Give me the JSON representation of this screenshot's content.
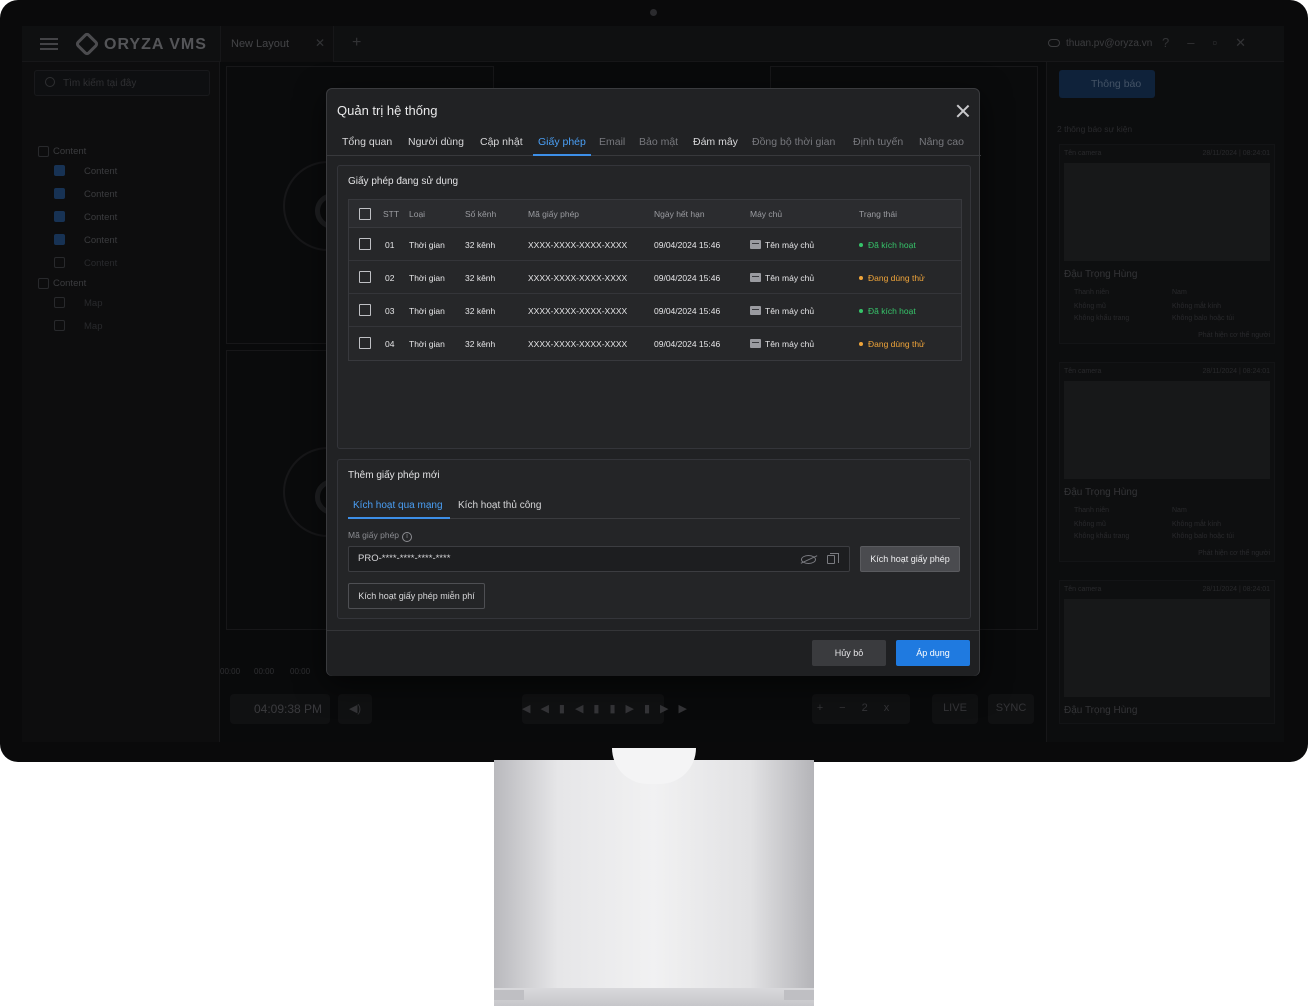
{
  "app": {
    "logo_text": "ORYZA VMS",
    "layout_tab": "New Layout",
    "user_email": "thuan.pv@oryza.vn",
    "search_placeholder": "Tìm kiếm tại đây"
  },
  "sidebar": {
    "groups": [
      {
        "label": "Content",
        "items": [
          "Content",
          "Content",
          "Content",
          "Content",
          "Content"
        ]
      },
      {
        "label": "Content",
        "items": [
          "Map",
          "Map"
        ]
      }
    ]
  },
  "playback": {
    "time": "04:09:38 PM",
    "timeline_ticks": [
      "00:00",
      "00:00",
      "00:00"
    ],
    "speed": "2x",
    "live_label": "LIVE",
    "sync_label": "SYNC"
  },
  "right_panel": {
    "notif_label": "Thông báo",
    "summary": "2 thông báo sự kiện",
    "events": [
      {
        "camera": "Tên camera",
        "time": "28/11/2024 | 08:24:01",
        "name": "Đậu Trọng Hùng",
        "attrs": [
          "Thanh niên",
          "Nam",
          "Không mũ",
          "Không mắt kính",
          "Không khẩu trang",
          "Không balo hoặc túi"
        ],
        "detect": "Phát hiện cơ thể người"
      },
      {
        "camera": "Tên camera",
        "time": "28/11/2024 | 08:24:01",
        "name": "Đậu Trọng Hùng",
        "attrs": [
          "Thanh niên",
          "Nam",
          "Không mũ",
          "Không mắt kính",
          "Không khẩu trang",
          "Không balo hoặc túi"
        ],
        "detect": "Phát hiện cơ thể người"
      },
      {
        "camera": "Tên camera",
        "time": "28/11/2024 | 08:24:01",
        "name": "Đậu Trọng Hùng",
        "attrs": [],
        "detect": ""
      }
    ]
  },
  "dialog": {
    "title": "Quản trị hệ thống",
    "tabs": [
      "Tổng quan",
      "Người dùng",
      "Cập nhật",
      "Giấy phép",
      "Email",
      "Bảo mật",
      "Đám mây",
      "Đồng bộ thời gian",
      "Định tuyến",
      "Nâng cao"
    ],
    "active_tab": "Giấy phép",
    "licenses_section": {
      "title": "Giấy phép đang sử dụng",
      "columns": [
        "STT",
        "Loại",
        "Số kênh",
        "Mã giấy phép",
        "Ngày hết hạn",
        "Máy chủ",
        "Trạng thái"
      ],
      "rows": [
        {
          "stt": "01",
          "type": "Thời gian",
          "channels": "32 kênh",
          "code": "XXXX-XXXX-XXXX-XXXX",
          "expiry": "09/04/2024 15:46",
          "server": "Tên máy chủ",
          "status": "Đã kích hoạt",
          "status_color": "#36c46a"
        },
        {
          "stt": "02",
          "type": "Thời gian",
          "channels": "32 kênh",
          "code": "XXXX-XXXX-XXXX-XXXX",
          "expiry": "09/04/2024 15:46",
          "server": "Tên máy chủ",
          "status": "Đang dùng thử",
          "status_color": "#f0a53a"
        },
        {
          "stt": "03",
          "type": "Thời gian",
          "channels": "32 kênh",
          "code": "XXXX-XXXX-XXXX-XXXX",
          "expiry": "09/04/2024 15:46",
          "server": "Tên máy chủ",
          "status": "Đã kích hoạt",
          "status_color": "#36c46a"
        },
        {
          "stt": "04",
          "type": "Thời gian",
          "channels": "32 kênh",
          "code": "XXXX-XXXX-XXXX-XXXX",
          "expiry": "09/04/2024 15:46",
          "server": "Tên máy chủ",
          "status": "Đang dùng thử",
          "status_color": "#f0a53a"
        }
      ]
    },
    "new_license": {
      "title": "Thêm giấy phép mới",
      "tabs": [
        "Kích hoạt qua mạng",
        "Kích hoạt thủ công"
      ],
      "field_label": "Mã giấy phép",
      "key_value": "PRO-****-****-****-****",
      "activate_button": "Kích hoạt giấy phép",
      "free_button": "Kích hoạt giấy phép miễn phí"
    },
    "cancel_button": "Hủy bỏ",
    "apply_button": "Áp dụng"
  }
}
